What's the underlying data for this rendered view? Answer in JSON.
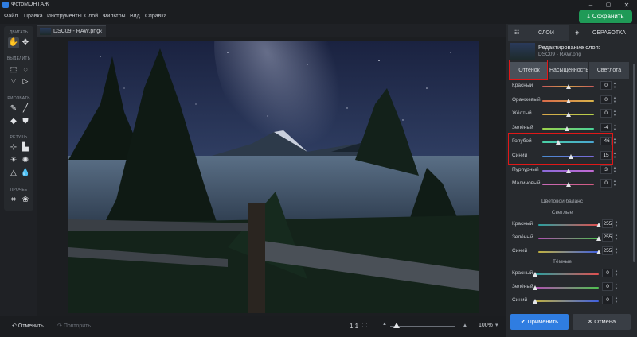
{
  "app": {
    "title": "ФотоМОНТАЖ"
  },
  "window_controls": {
    "minimize": "–",
    "maximize": "▢",
    "close": "✕"
  },
  "menu": [
    "Файл",
    "Правка",
    "Инструменты",
    "Слой",
    "Фильтры",
    "Вид",
    "Справка"
  ],
  "save_button": {
    "label": "Сохранить",
    "icon": "download-icon"
  },
  "toolbar": {
    "sections": [
      {
        "title": "ДВИГАТЬ",
        "tools": [
          "hand-icon",
          "move-icon"
        ]
      },
      {
        "title": "ВЫДЕЛИТЬ",
        "tools": [
          "rect-select-icon",
          "ellipse-select-icon",
          "lasso-icon"
        ]
      },
      {
        "title": "РИСОВАТЬ",
        "tools": [
          "brush-icon",
          "pencil-icon",
          "eraser-icon",
          "fill-icon"
        ]
      },
      {
        "title": "РЕТУШЬ",
        "tools": [
          "clone-icon",
          "stamp-icon",
          "brightness-icon",
          "sun-icon",
          "sharpen-icon",
          "drop-icon"
        ]
      },
      {
        "title": "ПРОЧЕЕ",
        "tools": [
          "crop-icon",
          "shapes-icon"
        ]
      }
    ]
  },
  "document_tab": {
    "name": "DSC09 - RAW.png",
    "close": "×"
  },
  "bottom_bar": {
    "undo": "Отменить",
    "redo": "Повторить",
    "ratio": "1:1",
    "zoom": "100%",
    "zoom_level": 0.1
  },
  "panel": {
    "tabs": [
      {
        "label": "СЛОИ",
        "icon": "sliders-icon"
      },
      {
        "label": "ОБРАБОТКА",
        "icon": "layers-icon"
      }
    ],
    "layer_title": "Редактирование слоя:",
    "layer_file": "DSC09 - RAW.png",
    "subtabs": [
      "Оттенок",
      "Насыщенность",
      "Светлота"
    ],
    "hue_sliders": [
      {
        "label": "Красный",
        "value": "0",
        "pos": 0.5,
        "color": "linear-gradient(90deg,#c85a5a,#d2a04a,#c85a5a)"
      },
      {
        "label": "Оранжевый",
        "value": "0",
        "pos": 0.5,
        "color": "linear-gradient(90deg,#d96b4a,#d9b44a)"
      },
      {
        "label": "Жёлтый",
        "value": "0",
        "pos": 0.5,
        "color": "linear-gradient(90deg,#d9a74a,#b7d24a)"
      },
      {
        "label": "Зелёный",
        "value": "-4",
        "pos": 0.48,
        "color": "linear-gradient(90deg,#9dd24a,#4ad29a)"
      },
      {
        "label": "Голубой",
        "value": "-46",
        "pos": 0.3,
        "color": "linear-gradient(90deg,#4ad2a6,#4aa6d2)"
      },
      {
        "label": "Синий",
        "value": "15",
        "pos": 0.56,
        "color": "linear-gradient(90deg,#4a8cd2,#7a6ad9)"
      },
      {
        "label": "Пурпурный",
        "value": "3",
        "pos": 0.51,
        "color": "linear-gradient(90deg,#8a6ad9,#c36ad2)"
      },
      {
        "label": "Малиновый",
        "value": "0",
        "pos": 0.5,
        "color": "linear-gradient(90deg,#c86ab8,#d25a80)"
      }
    ],
    "color_balance_title": "Цветовой баланс",
    "highlights_title": "Светлые",
    "highlights": [
      {
        "label": "Красный",
        "value": "255",
        "pos": 1.0,
        "color": "linear-gradient(90deg,#2aa0a0,#e05050)"
      },
      {
        "label": "Зелёный",
        "value": "255",
        "pos": 1.0,
        "color": "linear-gradient(90deg,#b050b0,#50c050)"
      },
      {
        "label": "Синий",
        "value": "255",
        "pos": 1.0,
        "color": "linear-gradient(90deg,#c0b040,#4060e0)"
      }
    ],
    "shadows_title": "Тёмные",
    "shadows": [
      {
        "label": "Красный",
        "value": "0",
        "pos": 0.0,
        "color": "linear-gradient(90deg,#2aa0a0,#e05050)"
      },
      {
        "label": "Зелёный",
        "value": "0",
        "pos": 0.0,
        "color": "linear-gradient(90deg,#b050b0,#50c050)"
      },
      {
        "label": "Синий",
        "value": "0",
        "pos": 0.0,
        "color": "linear-gradient(90deg,#c0b040,#4060e0)"
      }
    ],
    "apply": "Применить",
    "cancel": "Отмена"
  },
  "colors": {
    "accent": "#2f7de1",
    "save_green": "#1f9a57",
    "highlight_red": "#e01818"
  }
}
